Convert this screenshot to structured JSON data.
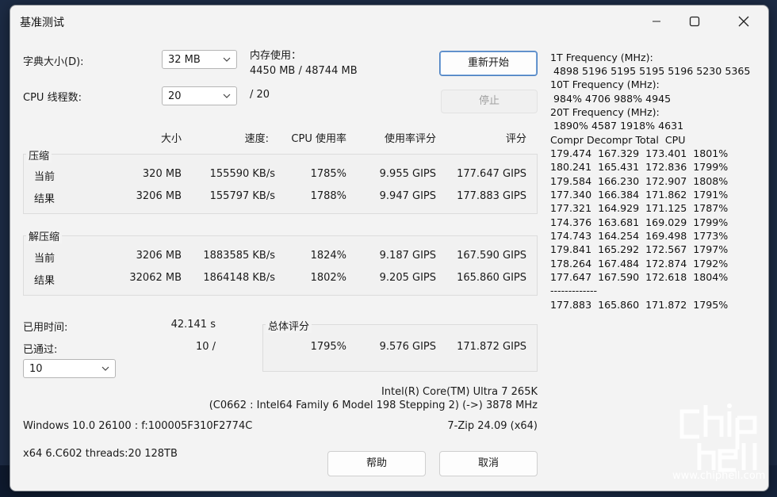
{
  "window": {
    "title": "基准测试"
  },
  "settings": {
    "dict_label": "字典大小(D):",
    "dict_value": "32 MB",
    "threads_label": "CPU 线程数:",
    "threads_value": "20",
    "threads_max": "/ 20",
    "mem_label": "内存使用：",
    "mem_value": "4450 MB / 48744 MB"
  },
  "buttons": {
    "restart": "重新开始",
    "stop": "停止",
    "help": "帮助",
    "cancel": "取消"
  },
  "columns": {
    "size": "大小",
    "speed": "速度:",
    "cpu_usage": "CPU 使用率",
    "usage_rating": "使用率评分",
    "rating": "评分"
  },
  "compress": {
    "title": "压缩",
    "current": {
      "label": "当前",
      "size": "320 MB",
      "speed": "155590 KB/s",
      "cpu": "1785%",
      "usage_rating": "9.955 GIPS",
      "rating": "177.647 GIPS"
    },
    "result": {
      "label": "结果",
      "size": "3206 MB",
      "speed": "155797 KB/s",
      "cpu": "1788%",
      "usage_rating": "9.947 GIPS",
      "rating": "177.883 GIPS"
    }
  },
  "decompress": {
    "title": "解压缩",
    "current": {
      "label": "当前",
      "size": "3206 MB",
      "speed": "1883585 KB/s",
      "cpu": "1824%",
      "usage_rating": "9.187 GIPS",
      "rating": "167.590 GIPS"
    },
    "result": {
      "label": "结果",
      "size": "32062 MB",
      "speed": "1864148 KB/s",
      "cpu": "1802%",
      "usage_rating": "9.205 GIPS",
      "rating": "165.860 GIPS"
    }
  },
  "status": {
    "elapsed_label": "已用时间:",
    "elapsed_value": "42.141 s",
    "passes_label": "已通过:",
    "passes_value": "10 /",
    "passes_select": "10"
  },
  "total": {
    "title": "总体评分",
    "cpu": "1795%",
    "usage_rating": "9.576 GIPS",
    "rating": "171.872 GIPS"
  },
  "system": {
    "cpu_name": "Intel(R) Core(TM) Ultra 7 265K",
    "cpu_detail": "(C0662 : Intel64 Family 6 Model 198 Stepping 2) (->) 3878 MHz",
    "os": "Windows 10.0 26100 :  f:100005F310F2774C",
    "version": "7-Zip 24.09 (x64)",
    "build": "x64 6.C602 threads:20 128TB"
  },
  "side_panel": {
    "freq1_label": "1T Frequency (MHz):",
    "freq1_values": " 4898 5196 5195 5195 5196 5230 5365",
    "freq10_label": "10T Frequency (MHz):",
    "freq10_values": " 984% 4706 988% 4945",
    "freq20_label": "20T Frequency (MHz):",
    "freq20_values": " 1890% 4587 1918% 4631",
    "table_header": "Compr Decompr Total  CPU",
    "rows": [
      "179.474  167.329  173.401  1801%",
      "180.241  165.431  172.836  1799%",
      "179.584  166.230  172.907  1808%",
      "177.340  166.384  171.862  1791%",
      "177.321  164.929  171.125  1787%",
      "174.376  163.681  169.029  1799%",
      "174.743  164.254  169.498  1773%",
      "179.841  165.292  172.567  1797%",
      "178.264  167.484  172.874  1792%",
      "177.647  167.590  172.618  1804%"
    ],
    "separator": "-------------",
    "summary": "177.883  165.860  171.872  1795%"
  },
  "watermark": {
    "text": "www.chiphell.com"
  },
  "icons": [
    "minimize-icon",
    "maximize-icon",
    "close-icon",
    "chevron-down-icon"
  ]
}
